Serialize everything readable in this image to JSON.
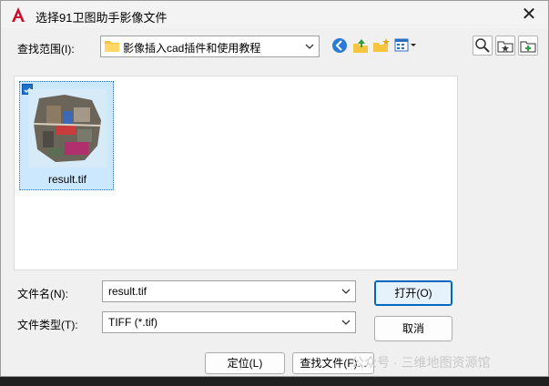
{
  "window": {
    "title": "选择91卫图助手影像文件",
    "close": "✕"
  },
  "lookin": {
    "label": "查找范围(I):",
    "value": "影像插入cad插件和使用教程"
  },
  "files": [
    {
      "name": "result.tif",
      "selected": true
    }
  ],
  "filename": {
    "label": "文件名(N):",
    "value": "result.tif"
  },
  "filetype": {
    "label": "文件类型(T):",
    "value": "TIFF (*.tif)"
  },
  "buttons": {
    "open": "打开(O)",
    "cancel": "取消",
    "locate": "定位(L)",
    "find": "查找文件(F)..."
  },
  "watermark": "公众号 · 三维地图资源馆",
  "colors": {
    "accent": "#0067c0",
    "selection": "#cce8ff",
    "app_red": "#c8102e"
  },
  "icons": [
    "autocad-logo-icon",
    "back-icon",
    "up-folder-icon",
    "new-folder-icon",
    "views-icon",
    "search-icon",
    "favorites-icon",
    "add-favorite-icon",
    "chevron-down-icon"
  ]
}
